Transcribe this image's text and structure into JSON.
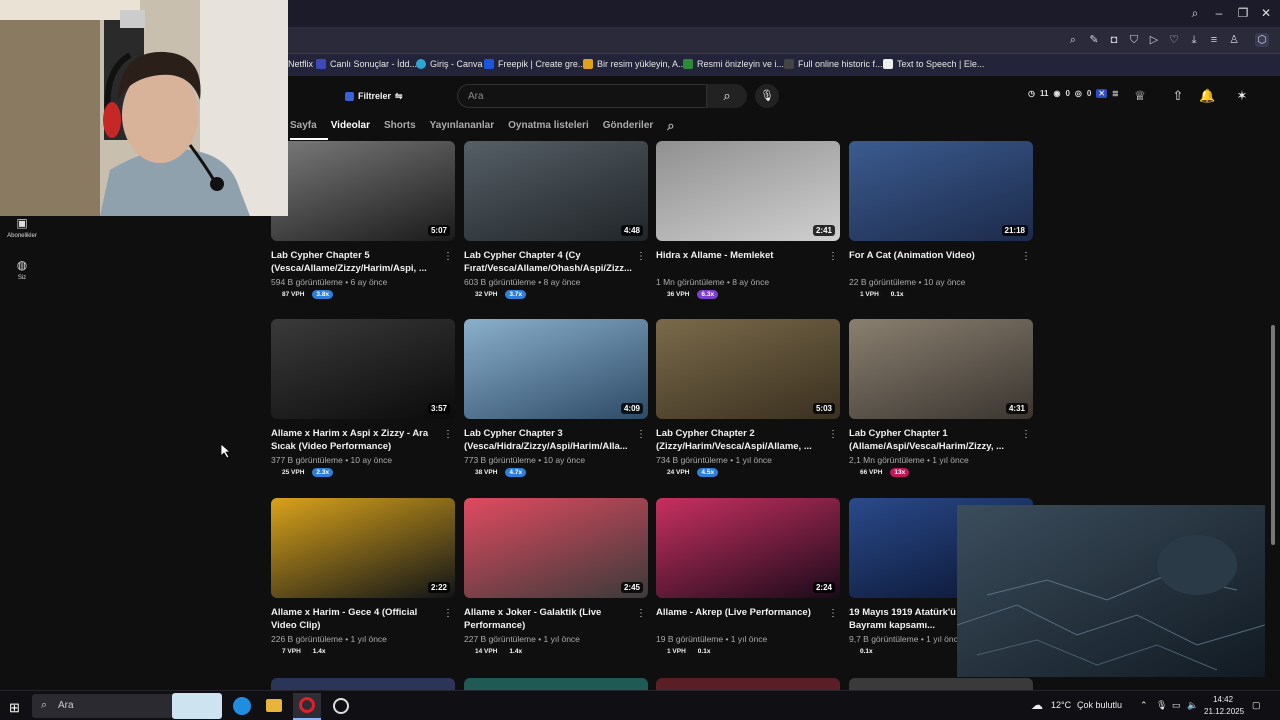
{
  "bookmarks": [
    {
      "label": "Netflix"
    },
    {
      "label": "Canlı Sonuçlar - İdd..."
    },
    {
      "label": "Giriş - Canva"
    },
    {
      "label": "Freepik | Create gre..."
    },
    {
      "label": "Bir resim yükleyin, A..."
    },
    {
      "label": "Resmi önizleyin ve i..."
    },
    {
      "label": "Full online historic f..."
    },
    {
      "label": "Text to Speech | Ele..."
    }
  ],
  "header": {
    "filters_label": "Filtreler",
    "search_placeholder": "Ara",
    "stats": {
      "views": "11",
      "likes": "0",
      "comments": "0"
    }
  },
  "tabs": [
    {
      "label": "Sayfa",
      "active": false
    },
    {
      "label": "Videolar",
      "active": true
    },
    {
      "label": "Shorts",
      "active": false
    },
    {
      "label": "Yayınlananlar",
      "active": false
    },
    {
      "label": "Oynatma listeleri",
      "active": false
    },
    {
      "label": "Gönderiler",
      "active": false
    }
  ],
  "sidebar": {
    "subscriptions_label": "Abonelikler",
    "you_label": "Siz"
  },
  "videos": [
    {
      "title": "Lab Cypher Chapter 5 (Vesca/Allame/Zizzy/Harim/Aspi, ...",
      "meta": "594 B görüntüleme • 6 ay önce",
      "duration": "5:07",
      "vph": "87 VPH",
      "mult": "3.8x",
      "mult_color": "#2e7fd9"
    },
    {
      "title": "Lab Cypher Chapter 4 (Cy Fırat/Vesca/Allame/Ohash/Aspi/Zizz...",
      "meta": "603 B görüntüleme • 8 ay önce",
      "duration": "4:48",
      "vph": "32 VPH",
      "mult": "3.7x",
      "mult_color": "#2e7fd9"
    },
    {
      "title": "Hidra x Allame - Memleket",
      "meta": "1 Mn görüntüleme • 8 ay önce",
      "duration": "2:41",
      "vph": "36 VPH",
      "mult": "6.3x",
      "mult_color": "#7b3fd1"
    },
    {
      "title": "For A Cat (Animation Video)",
      "meta": "22 B görüntüleme • 10 ay önce",
      "duration": "21:18",
      "vph": "1 VPH",
      "mult": "0.1x",
      "mult_color": "#111111"
    },
    {
      "title": "Allame x Harim x Aspi x Zizzy - Ara Sıcak (Video Performance)",
      "meta": "377 B görüntüleme • 10 ay önce",
      "duration": "3:57",
      "vph": "25 VPH",
      "mult": "2.3x",
      "mult_color": "#2e7fd9"
    },
    {
      "title": "Lab Cypher Chapter 3 (Vesca/Hidra/Zizzy/Aspi/Harim/Alla...",
      "meta": "773 B görüntüleme • 10 ay önce",
      "duration": "4:09",
      "vph": "38 VPH",
      "mult": "4.7x",
      "mult_color": "#2e7fd9"
    },
    {
      "title": "Lab Cypher Chapter 2 (Zizzy/Harim/Vesca/Aspi/Allame, ...",
      "meta": "734 B görüntüleme • 1 yıl önce",
      "duration": "5:03",
      "vph": "24 VPH",
      "mult": "4.5x",
      "mult_color": "#2e7fd9"
    },
    {
      "title": "Lab Cypher Chapter 1 (Allame/Aspi/Vesca/Harim/Zizzy, ...",
      "meta": "2,1 Mn görüntüleme • 1 yıl önce",
      "duration": "4:31",
      "vph": "66 VPH",
      "mult": "13x",
      "mult_color": "#c2185b"
    },
    {
      "title": "Allame x Harim - Gece 4 (Official Video Clip)",
      "meta": "226 B görüntüleme • 1 yıl önce",
      "duration": "2:22",
      "vph": "7 VPH",
      "mult": "1.4x",
      "mult_color": "#111111"
    },
    {
      "title": "Allame x Joker - Galaktik (Live Performance)",
      "meta": "227 B görüntüleme • 1 yıl önce",
      "duration": "2:45",
      "vph": "14 VPH",
      "mult": "1.4x",
      "mult_color": "#111111"
    },
    {
      "title": "Allame - Akrep (Live Performance)",
      "meta": "19 B görüntüleme • 1 yıl önce",
      "duration": "2:24",
      "vph": "1 VPH",
      "mult": "0.1x",
      "mult_color": "#111111"
    },
    {
      "title": "19 Mayıs 1919 Atatürk'ü A... ve Spor Bayramı kapsamı...",
      "meta": "9,7 B görüntüleme • 1 yıl önce",
      "duration": "",
      "vph": "",
      "mult": "0.1x",
      "mult_color": "#111111"
    }
  ],
  "taskbar": {
    "search_placeholder": "Ara",
    "weather": "12°C",
    "weather_desc": "Çok bulutlu",
    "time": "14:42",
    "date": "21.12.2025"
  }
}
